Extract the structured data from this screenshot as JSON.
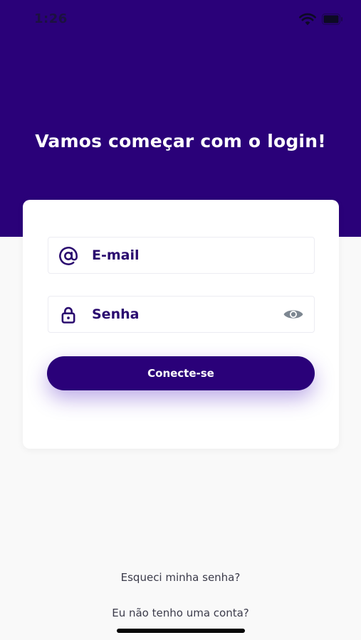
{
  "status_bar": {
    "time": "1:26",
    "wifi_icon": "wifi-icon",
    "battery_icon": "battery-icon"
  },
  "header": {
    "title": "Vamos começar com o login!"
  },
  "form": {
    "email": {
      "icon": "at-sign-icon",
      "placeholder": "E-mail"
    },
    "password": {
      "icon": "lock-icon",
      "placeholder": "Senha",
      "toggle_icon": "eye-icon"
    },
    "submit_label": "Conecte-se"
  },
  "links": {
    "forgot_password": "Esqueci minha senha?",
    "no_account": "Eu não tenho uma conta?"
  },
  "colors": {
    "brand": "#2a0179",
    "background": "#f9f9f9",
    "card": "#ffffff",
    "field_text": "#2a0b6f",
    "link_text": "#3b3b4a"
  }
}
